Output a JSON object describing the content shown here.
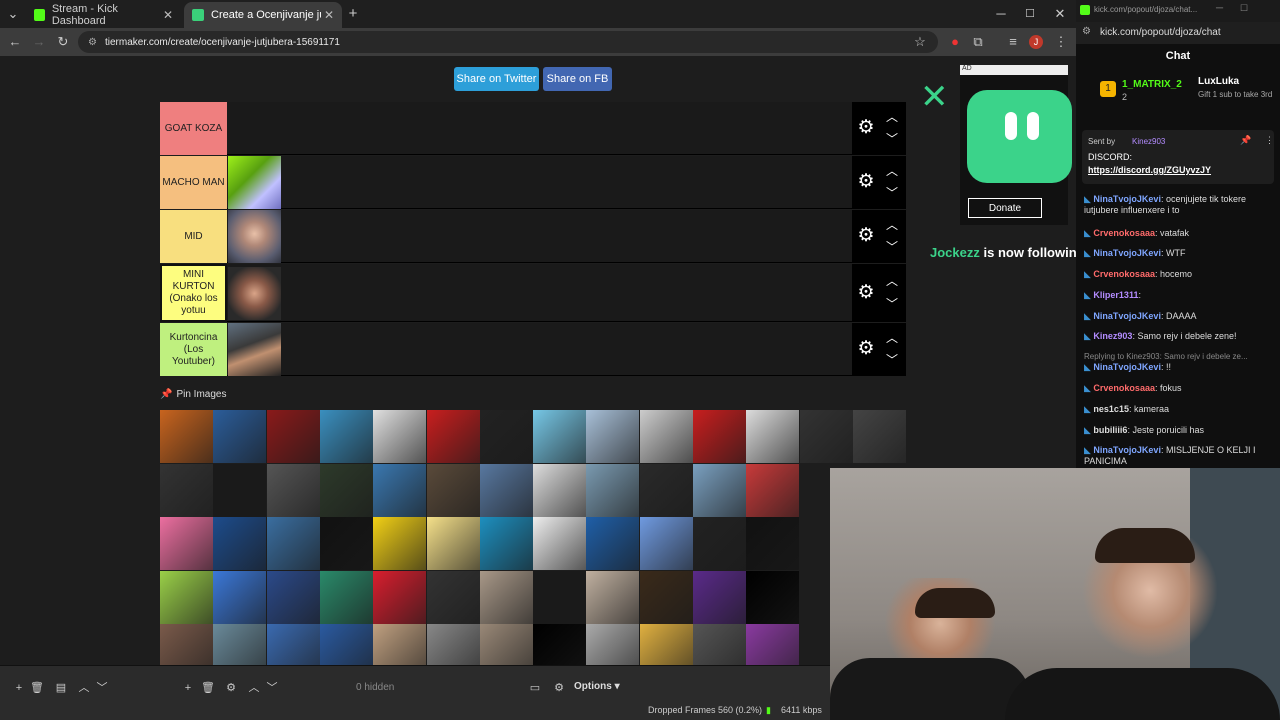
{
  "browser": {
    "tabs": [
      {
        "title": "Stream - Kick Dashboard",
        "favicon": "kick-icon"
      },
      {
        "title": "Create a Ocenjivanje jutjubera",
        "favicon": "tiermaker-icon"
      }
    ],
    "url": "tiermaker.com/create/ocenjivanje-jutjubera-15691171"
  },
  "page": {
    "share_twitter": "Share on Twitter",
    "share_fb": "Share on FB",
    "pin_images_label": "Pin Images",
    "tiers": [
      {
        "label": "GOAT KOZA",
        "color": "#ef7f7f",
        "images": 0
      },
      {
        "label": "MACHO MAN",
        "color": "#f5bf7f",
        "images": 1
      },
      {
        "label": "MID",
        "color": "#f8df7f",
        "images": 1
      },
      {
        "label": "MINI KURTON (Onako los yotuu",
        "color": "#fdfd7f",
        "images": 1
      },
      {
        "label": "Kurtoncina (Los Youtuber)",
        "color": "#bff07f",
        "images": 1
      }
    ]
  },
  "chat": {
    "url": "kick.com/popout/djoza/chat",
    "window_title": "kick.com/popout/djoza/chat...",
    "title": "Chat",
    "top_user1": "1_MATRIX_2",
    "top_user1_count": "2",
    "top_user2": "LuxLuka",
    "gift_text": "Gift 1 sub to take 3rd",
    "pinned_by_label": "Sent by",
    "pinned_by_user": "Kinez903",
    "pinned_text": "DISCORD:",
    "pinned_link": "https://discord.gg/ZGUyvzJY",
    "messages": [
      {
        "user": "NinaTvojoJKevi",
        "text": "ocenjujete tik tokere iutjubere influenxere i to",
        "color": "#7fa6ff"
      },
      {
        "user": "Crvenokosaaa",
        "text": "vatafak",
        "color": "#ff6b6b"
      },
      {
        "user": "NinaTvojoJKevi",
        "text": "WTF",
        "color": "#7fa6ff"
      },
      {
        "user": "Crvenokosaaa",
        "text": "hocemo",
        "color": "#ff6b6b"
      },
      {
        "user": "Kliper1311",
        "text": "",
        "color": "#b38cff"
      },
      {
        "user": "NinaTvojoJKevi",
        "text": "DAAAA",
        "color": "#7fa6ff"
      },
      {
        "user": "Kinez903",
        "text": "Samo rejv i debele zene!",
        "color": "#b38cff"
      },
      {
        "user": "NinaTvojoJKevi",
        "text": "!!",
        "color": "#7fa6ff"
      },
      {
        "user": "Crvenokosaaa",
        "text": "fokus",
        "color": "#ff6b6b"
      },
      {
        "user": "nes1c15",
        "text": "kameraa",
        "color": "#dddddd"
      },
      {
        "user": "bubiliii6",
        "text": "Jeste poruicili has",
        "color": "#dddddd"
      },
      {
        "user": "NinaTvojoJKevi",
        "text": "MISLJENJE O KELJI I PANICIMA",
        "color": "#7fa6ff"
      }
    ],
    "reply_text": "Replying to Kinez903: Samo rejv i debele ze..."
  },
  "overlay": {
    "follow_user": "Jockezz",
    "follow_text": "is now following!",
    "donate": "Donate",
    "ad_label": "AD"
  },
  "obs": {
    "hidden": "0 hidden",
    "options": "Options",
    "dropped": "Dropped Frames 560 (0.2%)",
    "bitrate": "6411 kbps"
  }
}
